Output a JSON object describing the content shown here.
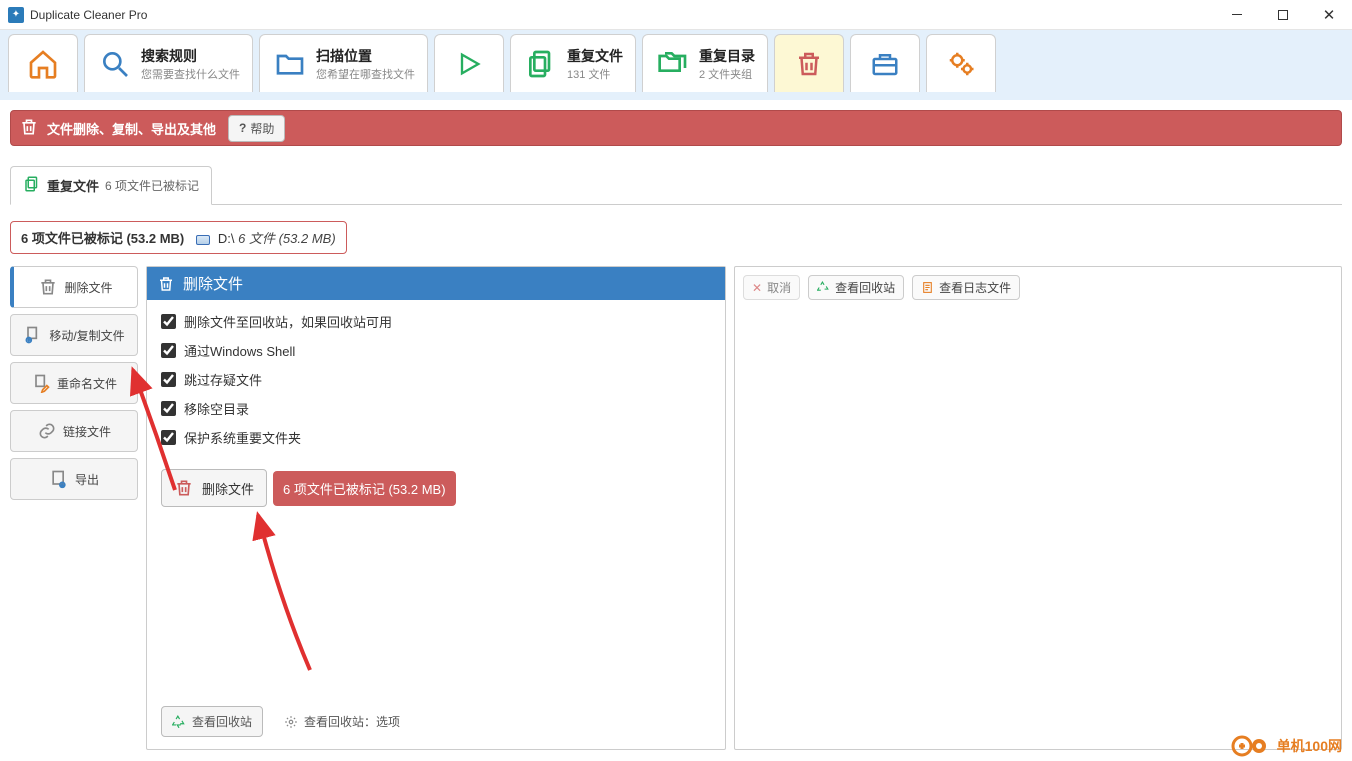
{
  "app": {
    "title": "Duplicate Cleaner Pro"
  },
  "toolbar": {
    "search_rules": {
      "title": "搜索规则",
      "sub": "您需要查找什么文件"
    },
    "scan_location": {
      "title": "扫描位置",
      "sub": "您希望在哪查找文件"
    },
    "dup_files": {
      "title": "重复文件",
      "sub": "131 文件"
    },
    "dup_folders": {
      "title": "重复目录",
      "sub": "2 文件夹组"
    }
  },
  "action_bar": {
    "title": "文件删除、复制、导出及其他",
    "help": "帮助"
  },
  "sub_tab": {
    "title": "重复文件",
    "info": "6 项文件已被标记"
  },
  "status": {
    "marked": "6 项文件已被标记 (53.2 MB)",
    "drive": "D:\\",
    "drive_files": "6 文件 (53.2 MB)"
  },
  "side": {
    "delete": "删除文件",
    "move_copy": "移动/复制文件",
    "rename": "重命名文件",
    "link": "链接文件",
    "export": "导出"
  },
  "panel": {
    "header": "删除文件",
    "opt1": "删除文件至回收站，如果回收站可用",
    "opt2": "通过Windows Shell",
    "opt3": "跳过存疑文件",
    "opt4": "移除空目录",
    "opt5": "保护系统重要文件夹",
    "delete_btn": "删除文件",
    "delete_badge": "6 项文件已被标记 (53.2 MB)",
    "view_recycle": "查看回收站",
    "recycle_options": "查看回收站：选项"
  },
  "right": {
    "cancel": "取消",
    "view_recycle": "查看回收站",
    "view_log": "查看日志文件"
  },
  "watermark": {
    "text": "单机100网"
  }
}
